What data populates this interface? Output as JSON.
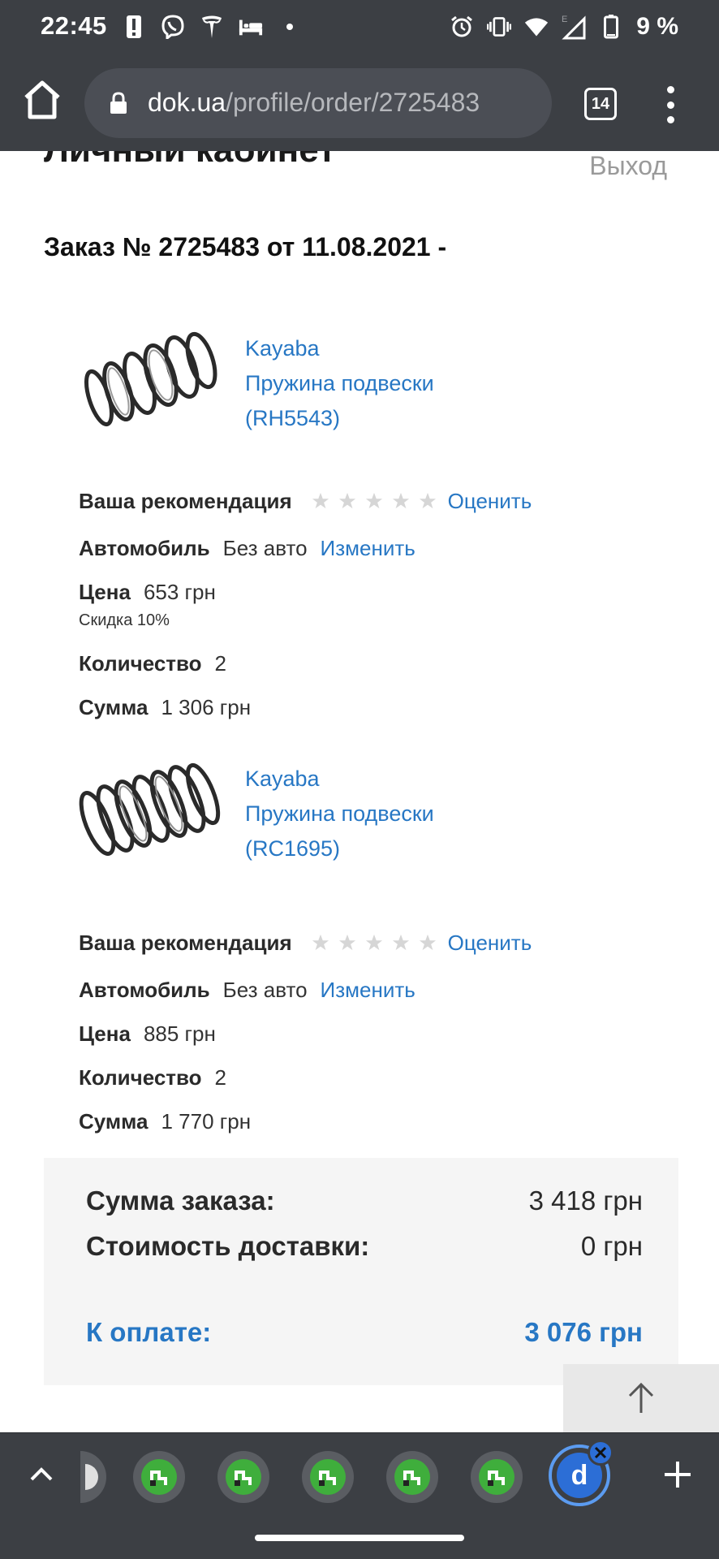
{
  "status_bar": {
    "time": "22:45",
    "battery_text": "9 %",
    "icons_left": [
      "alert-icon",
      "viber-icon",
      "tesla-icon",
      "bed-icon",
      "dot-icon"
    ],
    "icons_right": [
      "alarm-icon",
      "vibrate-icon",
      "wifi-icon",
      "signal-icon",
      "battery-icon"
    ]
  },
  "browser": {
    "url_host": "dok.ua",
    "url_path": "/profile/order/2725483",
    "tab_count": "14"
  },
  "page": {
    "title": "Личный кабинет",
    "logout": "Выход",
    "order_title": "Заказ № 2725483 от 11.08.2021 -"
  },
  "labels": {
    "recommendation": "Ваша рекомендация",
    "rate": "Оценить",
    "car": "Автомобиль",
    "change": "Изменить",
    "price": "Цена",
    "quantity": "Количество",
    "sum": "Сумма"
  },
  "items": [
    {
      "brand": "Kayaba",
      "name": "Пружина подвески",
      "code": "(RH5543)",
      "rating": 0,
      "car": "Без авто",
      "price": "653 грн",
      "discount": "Скидка 10%",
      "quantity": "2",
      "sum": "1 306 грн"
    },
    {
      "brand": "Kayaba",
      "name": "Пружина подвески",
      "code": "(RC1695)",
      "rating": 0,
      "car": "Без авто",
      "price": "885 грн",
      "quantity": "2",
      "sum": "1 770 грн"
    }
  ],
  "summary": {
    "order_sum_label": "Сумма заказа:",
    "order_sum_value": "3 418 грн",
    "delivery_label": "Стоимость доставки:",
    "delivery_value": "0 грн",
    "pay_label": "К оплате:",
    "pay_value": "3 076 грн"
  },
  "tab_strip": {
    "active_tab_letter": "d"
  },
  "colors": {
    "link": "#2777c4",
    "chrome_bg": "#3c3f44",
    "star": "#d6d6d6",
    "tab_icon_green": "#3fae3c",
    "active_tab_blue": "#2c6ed6"
  }
}
